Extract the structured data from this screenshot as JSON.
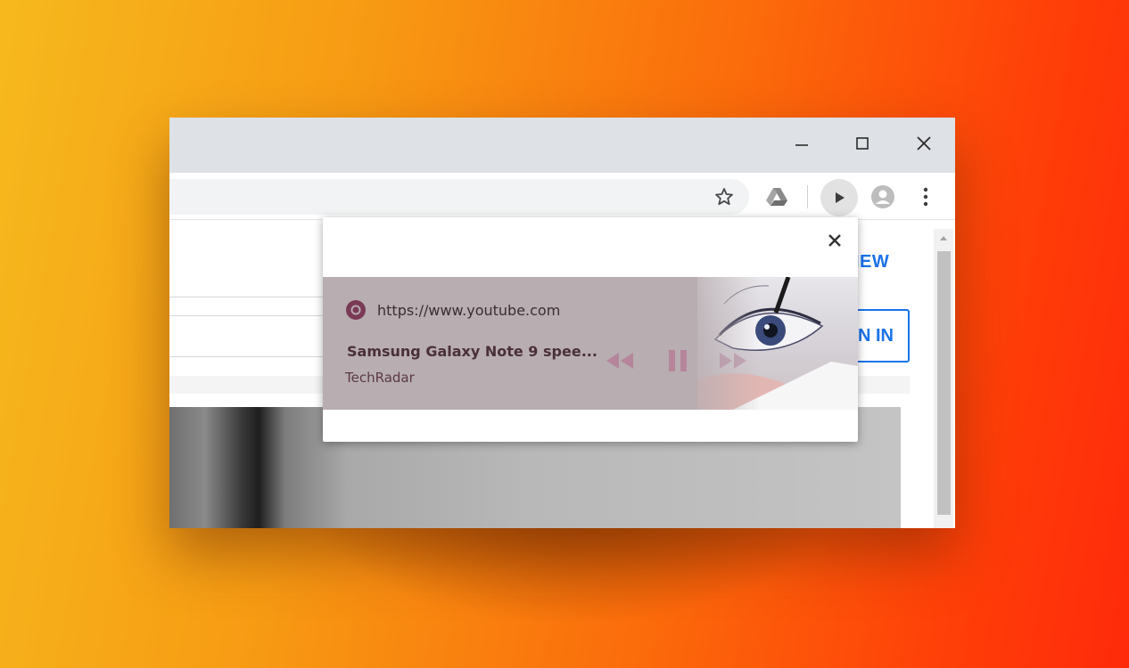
{
  "browser": {
    "window_controls": {
      "minimize": "minimize",
      "maximize": "maximize",
      "close": "close"
    },
    "toolbar_icons": [
      "star-icon",
      "google-drive-icon",
      "media-controls-icon",
      "profile-avatar-icon",
      "more-menu-icon"
    ]
  },
  "page": {
    "view_link_label": "IEW",
    "sign_in_label": "N IN"
  },
  "media_popup": {
    "origin": "https://www.youtube.com",
    "track_title": "Samsung Galaxy Note 9 spee...",
    "artist": "TechRadar",
    "controls": [
      "previous-track-icon",
      "pause-icon",
      "next-track-icon"
    ],
    "colors": {
      "card_bg": "#b8adb1",
      "controls": "#b5869b",
      "title": "#4a3038"
    }
  },
  "colors": {
    "accent": "#1a73e8",
    "titlebar": "#dee1e6"
  }
}
